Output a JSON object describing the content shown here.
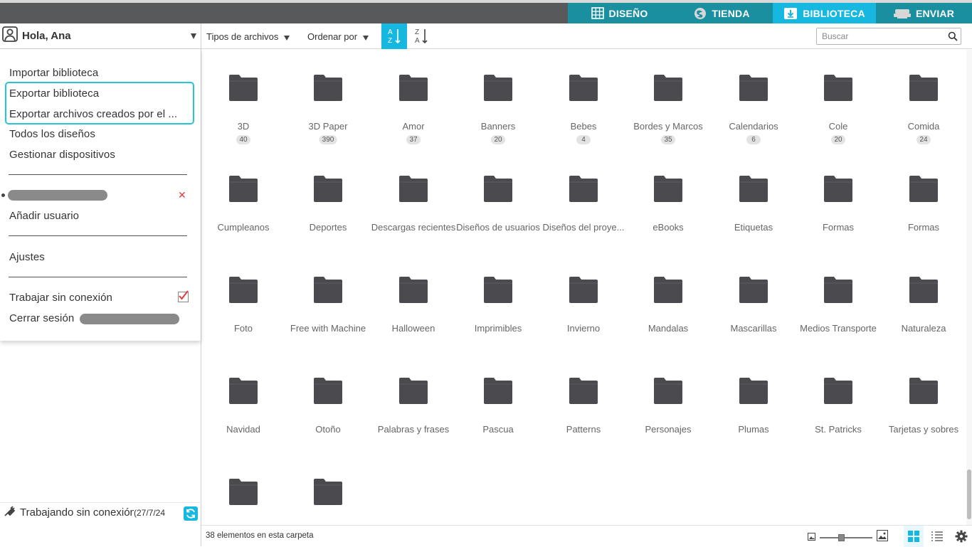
{
  "tabs": [
    {
      "label": "DISEÑO",
      "icon": "grid-icon"
    },
    {
      "label": "TIENDA",
      "icon": "silhouette-icon"
    },
    {
      "label": "BIBLIOTECA",
      "icon": "download-icon",
      "active": true
    },
    {
      "label": "ENVIAR",
      "icon": "cutter-icon"
    }
  ],
  "user": {
    "greeting": "Hola, Ana"
  },
  "menu": {
    "import": "Importar biblioteca",
    "export": "Exportar biblioteca",
    "export_user": "Exportar archivos creados por el ...",
    "all_designs": "Todos los diseños",
    "manage_devices": "Gestionar dispositivos",
    "add_user": "Añadir usuario",
    "settings": "Ajustes",
    "offline_mode": "Trabajar sin conexión",
    "offline_checked": true,
    "logout": "Cerrar sesión",
    "remove_glyph": "✕"
  },
  "offline_status": {
    "text": "Trabajando sin conexión",
    "date": "(27/7/24"
  },
  "toolbar": {
    "file_types": "Tipos de archivos",
    "sort_by": "Ordenar por",
    "search_placeholder": "Buscar"
  },
  "folders": [
    {
      "name": "3D",
      "count": "40"
    },
    {
      "name": "3D Paper",
      "count": "390"
    },
    {
      "name": "Amor",
      "count": "37"
    },
    {
      "name": "Banners",
      "count": "20"
    },
    {
      "name": "Bebes",
      "count": "4"
    },
    {
      "name": "Bordes y Marcos",
      "count": "35"
    },
    {
      "name": "Calendarios",
      "count": "6"
    },
    {
      "name": "Cole",
      "count": "20"
    },
    {
      "name": "Comida",
      "count": "24"
    },
    {
      "name": "Cumpleanos"
    },
    {
      "name": "Deportes"
    },
    {
      "name": "Descargas recientes"
    },
    {
      "name": "Diseños de usuarios"
    },
    {
      "name": "Diseños del proye..."
    },
    {
      "name": "eBooks"
    },
    {
      "name": "Etiquetas"
    },
    {
      "name": "Formas"
    },
    {
      "name": "Formas"
    },
    {
      "name": "Foto"
    },
    {
      "name": "Free with Machine"
    },
    {
      "name": "Halloween"
    },
    {
      "name": "Imprimibles"
    },
    {
      "name": "Invierno"
    },
    {
      "name": "Mandalas"
    },
    {
      "name": "Mascarillas"
    },
    {
      "name": "Medios Transporte"
    },
    {
      "name": "Naturaleza"
    },
    {
      "name": "Navidad"
    },
    {
      "name": "Otoño"
    },
    {
      "name": "Palabras y frases"
    },
    {
      "name": "Pascua"
    },
    {
      "name": "Patterns"
    },
    {
      "name": "Personajes"
    },
    {
      "name": "Plumas"
    },
    {
      "name": "St. Patricks"
    },
    {
      "name": "Tarjetas y sobres"
    },
    {
      "name": ""
    },
    {
      "name": ""
    }
  ],
  "status": {
    "count_text": "38 elementos en esta carpeta",
    "zoom_level": 0.4
  },
  "colors": {
    "accent": "#16b8e0",
    "tabbar": "#1a8fa0",
    "folder": "#4a4a4f",
    "highlight": "#25c6d9"
  }
}
